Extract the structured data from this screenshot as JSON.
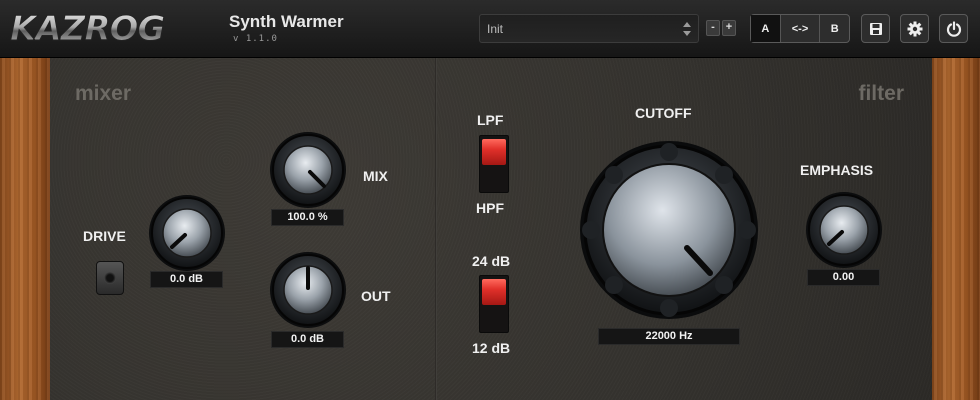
{
  "header": {
    "brand": "KAZROG",
    "plugin_name": "Synth Warmer",
    "version": "v 1.1.0",
    "preset": "Init",
    "minus_label": "-",
    "plus_label": "+",
    "ab": {
      "a_label": "A",
      "copy_label": "<->",
      "b_label": "B",
      "active": "A"
    },
    "icons": [
      "save-icon",
      "gear-icon",
      "power-icon"
    ]
  },
  "mixer": {
    "section_label": "mixer",
    "drive": {
      "label": "DRIVE",
      "value": "0.0 dB"
    },
    "mix": {
      "label": "MIX",
      "value": "100.0 %"
    },
    "out": {
      "label": "OUT",
      "value": "0.0 dB"
    }
  },
  "filter": {
    "section_label": "filter",
    "type_switch": {
      "top_label": "LPF",
      "bottom_label": "HPF",
      "position": "LPF"
    },
    "slope_switch": {
      "top_label": "24 dB",
      "bottom_label": "12 dB",
      "position": "24 dB"
    },
    "cutoff": {
      "label": "CUTOFF",
      "value": "22000 Hz"
    },
    "emphasis": {
      "label": "EMPHASIS",
      "value": "0.00"
    }
  },
  "colors": {
    "switch_red": "#e0302a",
    "wood": "#a25a24",
    "panel": "#36332f"
  }
}
